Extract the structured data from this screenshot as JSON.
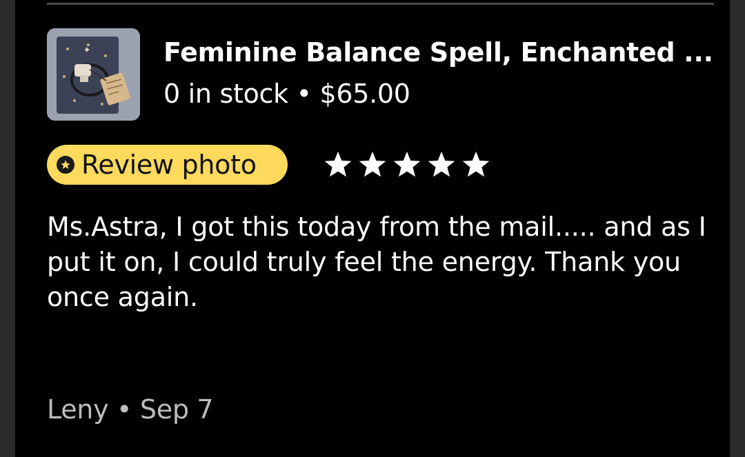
{
  "product": {
    "title": "Feminine Balance Spell, Enchanted ...",
    "stock_and_price": "0 in stock • $65.00",
    "thumbnail": "product-photo"
  },
  "review": {
    "badge_label": "Review photo",
    "badge_icon": "review-star-badge-icon",
    "rating": 5,
    "rating_max": 5,
    "text": "Ms.Astra, I got this today from the mail..... and as I put it on, I could truly feel the energy. Thank you once again.",
    "footer": "Leny • Sep 7"
  },
  "colors": {
    "background": "#000000",
    "badge_background": "#fdd95c",
    "text_primary": "#ffffff",
    "text_secondary": "#bdbdbd"
  }
}
